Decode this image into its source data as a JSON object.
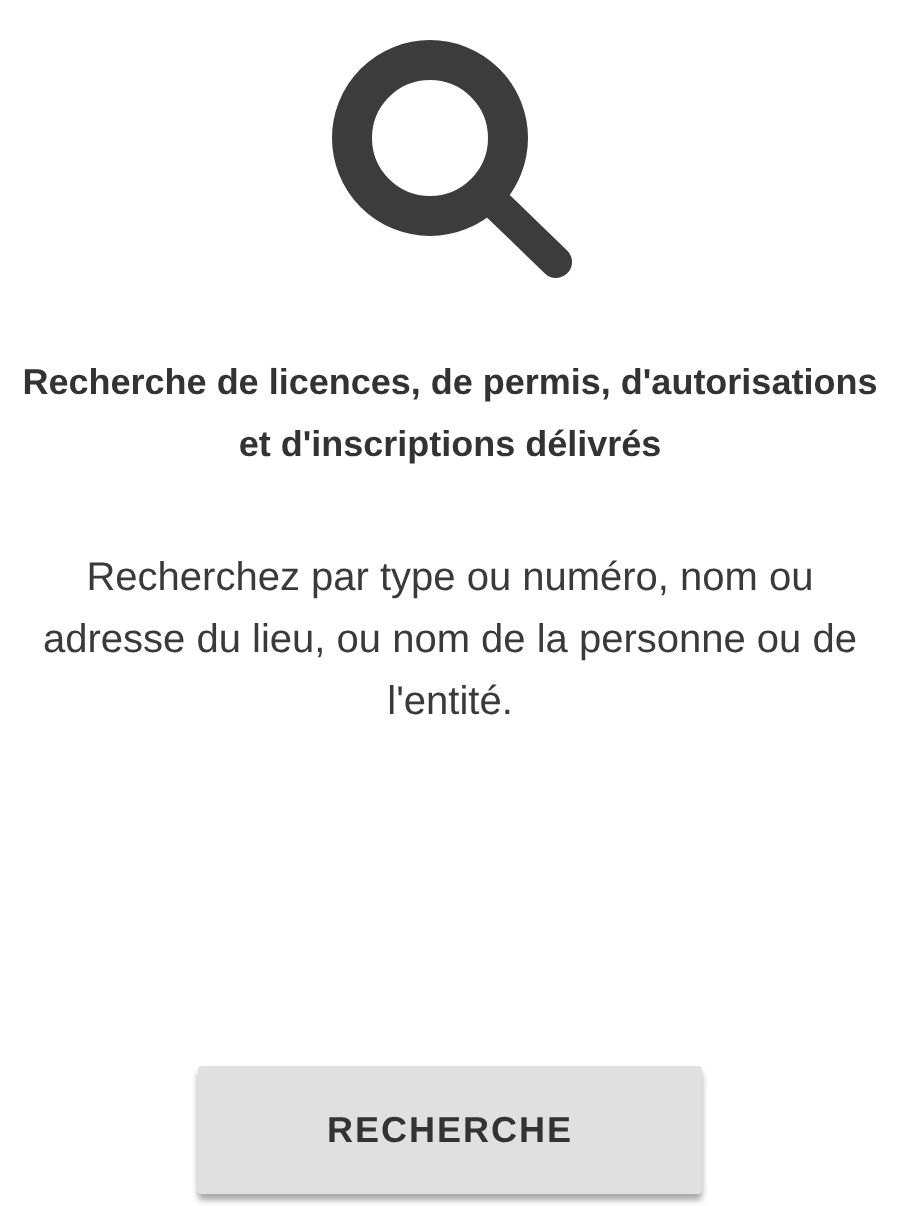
{
  "title": "Recherche de licences, de permis, d'autorisations et d'inscriptions délivrés",
  "description": "Recherchez par type ou numéro, nom ou adresse du lieu, ou nom de la personne ou de l'entité.",
  "button": {
    "label": "RECHERCHE"
  }
}
